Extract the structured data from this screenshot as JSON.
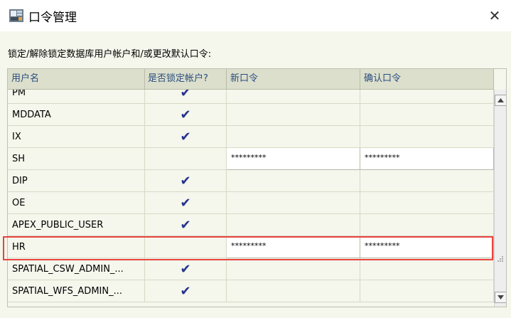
{
  "window": {
    "title": "口令管理"
  },
  "instruction": "锁定/解除锁定数据库用户帐户和/或更改默认口令:",
  "grid": {
    "columns": [
      "用户名",
      "是否锁定帐户?",
      "新口令",
      "确认口令"
    ],
    "rows": [
      {
        "user": "PM",
        "locked": true,
        "new_pw": "",
        "confirm_pw": ""
      },
      {
        "user": "MDDATA",
        "locked": true,
        "new_pw": "",
        "confirm_pw": ""
      },
      {
        "user": "IX",
        "locked": true,
        "new_pw": "",
        "confirm_pw": ""
      },
      {
        "user": "SH",
        "locked": false,
        "new_pw": "*********",
        "confirm_pw": "*********"
      },
      {
        "user": "DIP",
        "locked": true,
        "new_pw": "",
        "confirm_pw": ""
      },
      {
        "user": "OE",
        "locked": true,
        "new_pw": "",
        "confirm_pw": ""
      },
      {
        "user": "APEX_PUBLIC_USER",
        "locked": true,
        "new_pw": "",
        "confirm_pw": ""
      },
      {
        "user": "HR",
        "locked": false,
        "new_pw": "*********",
        "confirm_pw": "*********"
      },
      {
        "user": "SPATIAL_CSW_ADMIN_...",
        "locked": true,
        "new_pw": "",
        "confirm_pw": ""
      },
      {
        "user": "SPATIAL_WFS_ADMIN_...",
        "locked": true,
        "new_pw": "",
        "confirm_pw": ""
      }
    ],
    "check_glyph": "✔",
    "highlighted_row": "HR"
  },
  "colors": {
    "header_text": "#2a4d7e",
    "check": "#24338c",
    "highlight": "#e8433f"
  }
}
